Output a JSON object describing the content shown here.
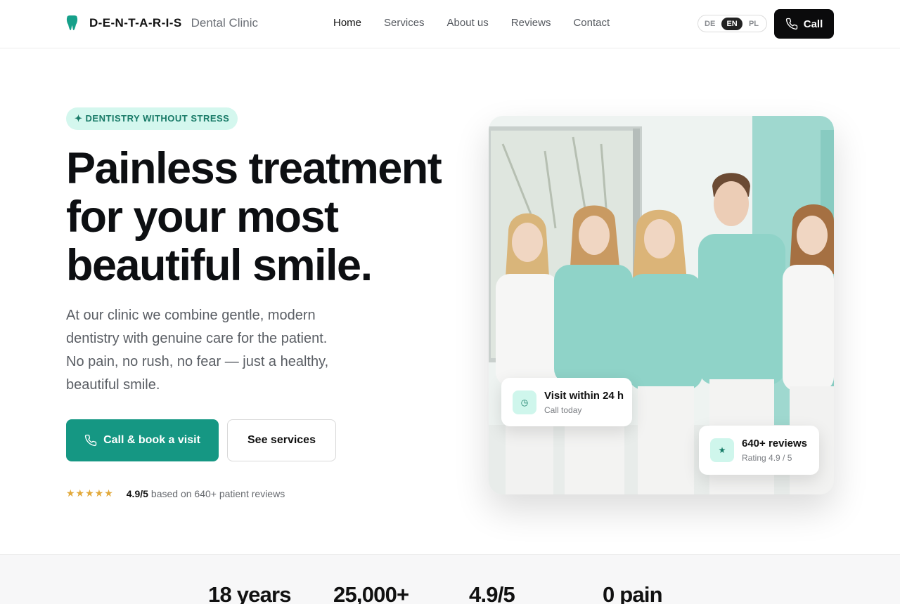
{
  "header": {
    "brand_name": "D-E-N-T-A-R-I-S",
    "brand_sub": "Dental Clinic",
    "nav": [
      {
        "label": "Home"
      },
      {
        "label": "Services"
      },
      {
        "label": "About us"
      },
      {
        "label": "Reviews"
      },
      {
        "label": "Contact"
      }
    ],
    "languages": [
      "DE",
      "EN",
      "PL"
    ],
    "selected_language": "EN",
    "call_label": "Call"
  },
  "hero": {
    "tag": "✦ DENTISTRY WITHOUT STRESS",
    "headline": "Painless treatment for your most beautiful smile.",
    "lead": "At our clinic we combine gentle, modern dentistry with genuine care for the patient. No pain, no rush, no fear — just a healthy, beautiful smile.",
    "primary_cta": "Call & book a visit",
    "secondary_cta": "See services",
    "stars": "★★★★★",
    "rating_value": "4.9/5",
    "rating_text": "based on 640+ patient reviews"
  },
  "photo_cards": {
    "visit": {
      "title": "Visit within 24 h",
      "sub": "Call today",
      "icon": "clock-icon"
    },
    "reviews": {
      "title": "640+ reviews",
      "sub": "Rating 4.9 / 5",
      "icon": "star-icon"
    }
  },
  "stats": [
    {
      "value": "18 years"
    },
    {
      "value": "25,000+"
    },
    {
      "value": "4.9/5"
    },
    {
      "value": "0 pain"
    }
  ],
  "colors": {
    "accent": "#159783",
    "accent_light": "#d4f7ee",
    "dark": "#0b0b0c",
    "star": "#e2a93b"
  }
}
